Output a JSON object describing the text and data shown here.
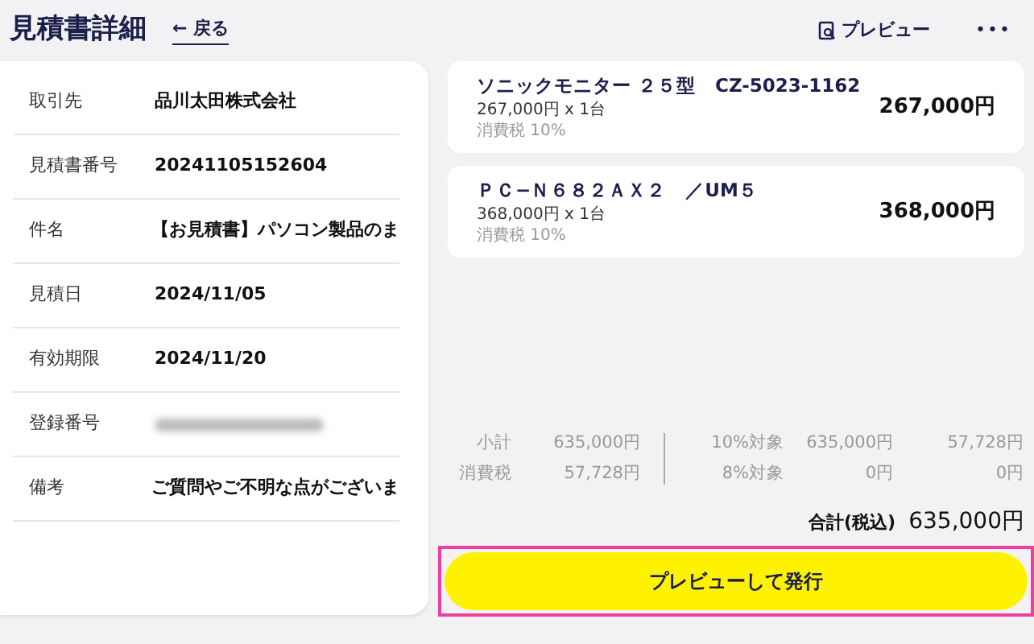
{
  "header": {
    "title": "見積書詳細",
    "back_link": "← 戻る",
    "preview_link": "プレビュー",
    "more_menu": "•••"
  },
  "details": [
    {
      "label": "取引先",
      "value": "品川太田株式会社"
    },
    {
      "label": "見積書番号",
      "value": "20241105152604"
    },
    {
      "label": "件名",
      "value": "【お見積書】パソコン製品のま"
    },
    {
      "label": "見積日",
      "value": "2024/11/05"
    },
    {
      "label": "有効期限",
      "value": "2024/11/20"
    },
    {
      "label": "登録番号",
      "redacted": true
    },
    {
      "label": "備考",
      "value": "ご質問やご不明な点がございま"
    }
  ],
  "items": [
    {
      "name": "ソニックモニター ２５型　CZ-5023-1162",
      "unit": "267,000円 x 1台",
      "tax": "消費税 10%",
      "amount": "267,000円"
    },
    {
      "name": "ＰＣ−Ｎ６８２ＡＸ２　／UM５",
      "unit": "368,000円 x 1台",
      "tax": "消費税 10%",
      "amount": "368,000円"
    }
  ],
  "summary": {
    "left": [
      {
        "label": "小計",
        "value": "635,000円"
      },
      {
        "label": "消費税",
        "value": "57,728円"
      }
    ],
    "right": [
      {
        "label": "10%対象",
        "base": "635,000円",
        "tax": "57,728円"
      },
      {
        "label": "8%対象",
        "base": "0円",
        "tax": "0円"
      }
    ],
    "total_label": "合計(税込)",
    "total": "635,000円"
  },
  "issue_button": {
    "label": "プレビューして発行",
    "highlighted": true
  }
}
